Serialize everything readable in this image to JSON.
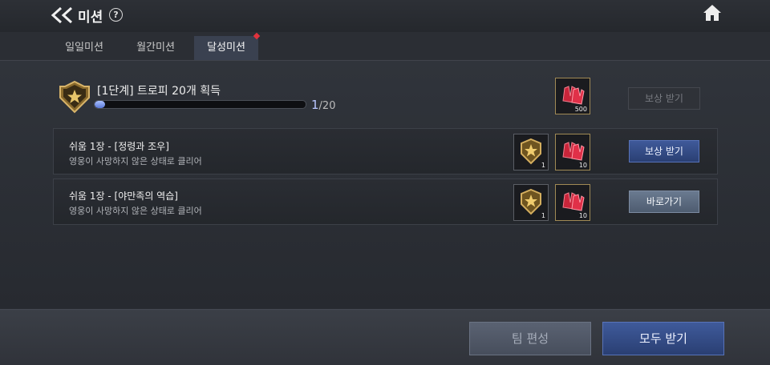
{
  "header": {
    "title": "미션",
    "help_symbol": "?",
    "back_icon": "double-chevron-left-icon",
    "home_icon": "home-icon"
  },
  "tabs": [
    {
      "label": "일일미션",
      "active": false
    },
    {
      "label": "월간미션",
      "active": false
    },
    {
      "label": "달성미션",
      "active": true,
      "notification": true
    }
  ],
  "stage": {
    "title": "[1단계] 트로피 20개 획득",
    "progress_current": "1",
    "progress_total": "/20",
    "progress_fraction": 0.05,
    "reward": {
      "icon": "red-gloves-icon",
      "qty": "500"
    },
    "button_label": "보상 받기",
    "button_enabled": false
  },
  "missions": [
    {
      "title": "쉬움 1장 - [정령과 조우]",
      "desc": "영웅이 사망하지 않은 상태로 클리어",
      "rewards": [
        {
          "icon": "star-shield-trophy-icon",
          "qty": "1"
        },
        {
          "icon": "red-gloves-icon",
          "qty": "10"
        }
      ],
      "button_label": "보상 받기",
      "button_style": "blue"
    },
    {
      "title": "쉬움 1장 - [야만족의 역습]",
      "desc": "영웅이 사망하지 않은 상태로 클리어",
      "rewards": [
        {
          "icon": "star-shield-trophy-icon",
          "qty": "1"
        },
        {
          "icon": "red-gloves-icon",
          "qty": "10"
        }
      ],
      "button_label": "바로가기",
      "button_style": "gray"
    }
  ],
  "footer": {
    "team_edit_label": "팀 편성",
    "claim_all_label": "모두 받기"
  },
  "colors": {
    "accent_blue": "#2a3f73",
    "notification_red": "#e0323c",
    "progress_fill": "#7f9cf0"
  }
}
